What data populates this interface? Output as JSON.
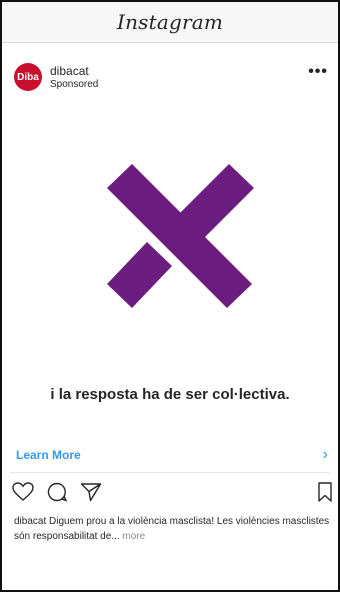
{
  "app": {
    "title": "Instagram"
  },
  "post": {
    "avatar_text": "Diba",
    "account": "dibacat",
    "label": "Sponsored",
    "menu_icon": "ellipsis-icon",
    "media": {
      "logo": "purple-x-mark",
      "text": "i la resposta ha de ser col·lectiva.",
      "accent_color": "#6b1e7f"
    },
    "cta": {
      "label": "Learn More",
      "icon": "chevron-right-icon",
      "color": "#3897f0"
    },
    "actions": [
      "heart-icon",
      "comment-icon",
      "share-icon",
      "bookmark-icon"
    ],
    "caption": {
      "user": "dibacat",
      "text": " Diguem prou a la violència masclista! Les violències masclistes són responsabilitat de...",
      "more": " more"
    }
  }
}
